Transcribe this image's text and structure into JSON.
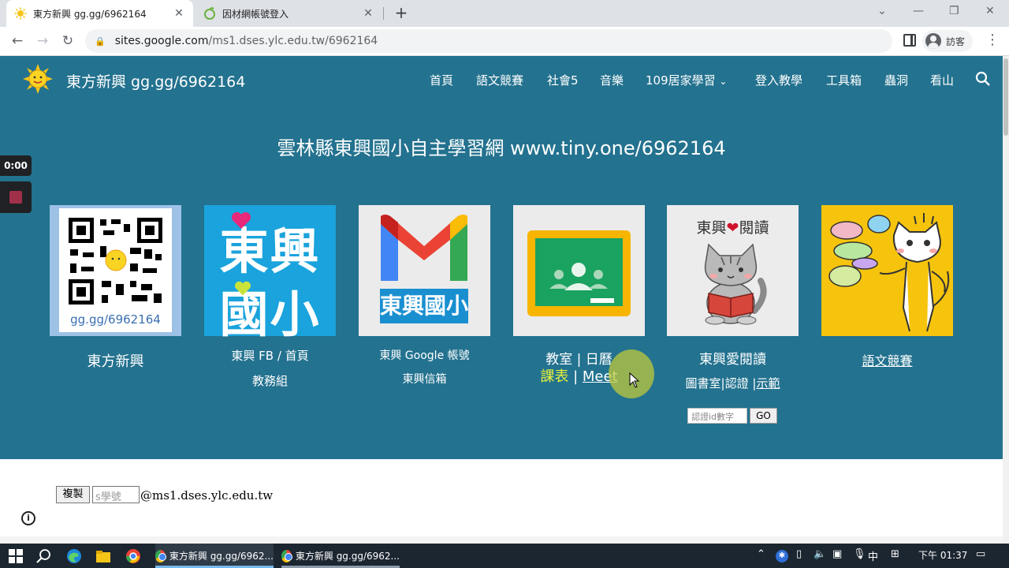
{
  "browser": {
    "tabs": [
      {
        "title": "東方新興 gg.gg/6962164",
        "active": true
      },
      {
        "title": "因材網帳號登入",
        "active": false
      }
    ],
    "url_host": "sites.google.com",
    "url_path": "/ms1.dses.ylc.edu.tw/6962164",
    "profile_label": "訪客"
  },
  "site": {
    "title": "東方新興 gg.gg/6962164",
    "nav": [
      "首頁",
      "語文競賽",
      "社會5",
      "音樂",
      "109居家學習",
      "登入教學",
      "工具箱",
      "蟲洞",
      "看山"
    ],
    "hero": "雲林縣東興國小自主學習網  www.tiny.one/6962164",
    "tiles": {
      "qr_caption_img": "gg.gg/6962164",
      "qr_label": "東方新興",
      "school_logo_top": "東興",
      "school_logo_bottom": "國小",
      "fb_label": "東興 FB / 首頁",
      "fb_sub": "教務組",
      "gmail_badge": "東興國小",
      "gmail_label": "東興 Google 帳號",
      "gmail_sub": "東興信箱",
      "classroom_label": "教室 | 日曆",
      "classroom_sub_a": "課表",
      "classroom_sub_sep": " | ",
      "classroom_sub_b": "Meet",
      "reading_img_title_a": "東興",
      "reading_img_title_b": "閱讀",
      "reading_label": "東興愛閱讀",
      "reading_sub_a": "圖書室",
      "reading_sub_b": "認證",
      "reading_sub_c": "示範",
      "contest_label": "語文競賽"
    },
    "id_placeholder": "認證id數字",
    "go_label": "GO",
    "copy_label": "複製",
    "student_placeholder": "s學號",
    "email_domain": "@ms1.dses.ylc.edu.tw"
  },
  "recorder": {
    "time": "0:00"
  },
  "taskbar": {
    "apps": [
      {
        "title": "東方新興 gg.gg/6962..."
      },
      {
        "title": "東方新興 gg.gg/6962..."
      }
    ],
    "ime": "中",
    "clock": "下午 01:37"
  },
  "colors": {
    "site_bg": "#23728f",
    "link_yellow": "#e6f03c"
  }
}
